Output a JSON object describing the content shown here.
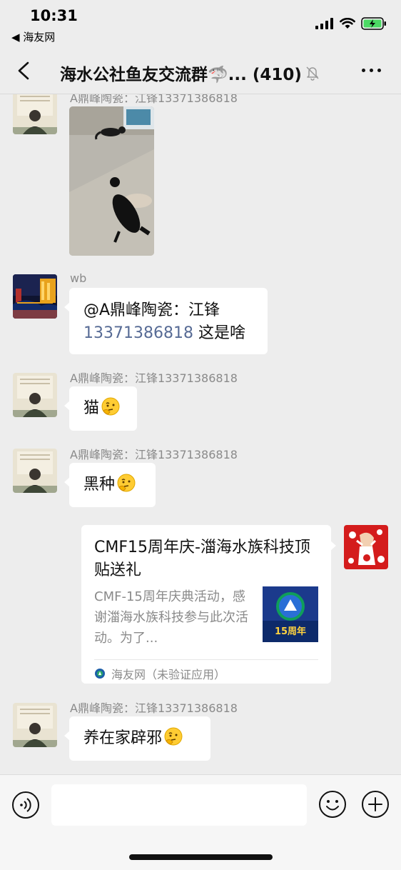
{
  "status": {
    "time": "10:31",
    "back_app": "◀ 海友网"
  },
  "nav": {
    "title": "海水公社鱼友交流群🦈... (410)"
  },
  "messages": [
    {
      "sender": "A鼎峰陶瓷：江锋13371386818",
      "type": "image"
    },
    {
      "sender": "wb",
      "mention": "@A鼎峰陶瓷：江锋",
      "mention_phone": "13371386818",
      "text": " 这是啥"
    },
    {
      "sender": "A鼎峰陶瓷：江锋13371386818",
      "text": "猫"
    },
    {
      "sender": "A鼎峰陶瓷：江锋13371386818",
      "text": "黑种"
    },
    {
      "type": "link_card",
      "title": "CMF15周年庆-湽海水族科技顶贴送礼",
      "description": "CMF-15周年庆典活动，感谢湽海水族科技参与此次活动。为了...",
      "thumb_text": "15周年",
      "source": "海友网（未验证应用）"
    },
    {
      "sender": "A鼎峰陶瓷：江锋13371386818",
      "text": "养在家辟邪"
    }
  ],
  "input": {
    "placeholder": ""
  }
}
